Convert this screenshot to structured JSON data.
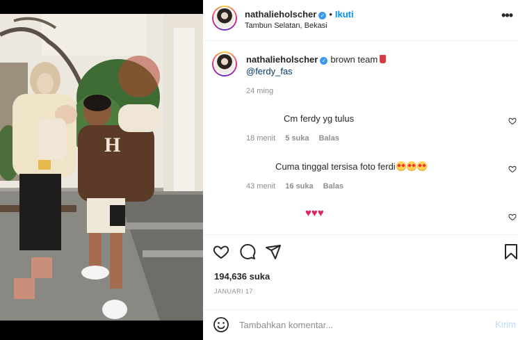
{
  "header": {
    "username": "nathalieholscher",
    "separator": "•",
    "follow_label": "Ikuti",
    "location": "Tambun Selatan, Bekasi",
    "more_icon": "more-horizontal-icon"
  },
  "caption": {
    "username": "nathalieholscher",
    "text": "brown team",
    "emoji_icon": "cup-icon",
    "mention": "@ferdy_fas",
    "time": "24 ming"
  },
  "comments": [
    {
      "text": "Cm ferdy yg tulus",
      "time": "18 menit",
      "likes": "5 suka",
      "reply": "Balas"
    },
    {
      "text": "Cuma tinggal tersisa foto ferdi",
      "emoji": "smiling-face-with-hearts",
      "time": "43 menit",
      "likes": "16 suka",
      "reply": "Balas"
    },
    {
      "text": "",
      "emoji": "three-red-hearts"
    }
  ],
  "actions": {
    "like_icon": "heart-icon",
    "comment_icon": "comment-icon",
    "share_icon": "share-icon",
    "save_icon": "bookmark-icon",
    "likes_count": "194,636 suka",
    "date": "JANUARI 17"
  },
  "add_comment": {
    "placeholder": "Tambahkan komentar...",
    "post_label": "Kirim"
  },
  "colors": {
    "accent": "#0095f6",
    "mention": "#00376b",
    "muted": "#8e8e8e",
    "heart": "#e0245e",
    "post_disabled": "#b3dbff"
  }
}
